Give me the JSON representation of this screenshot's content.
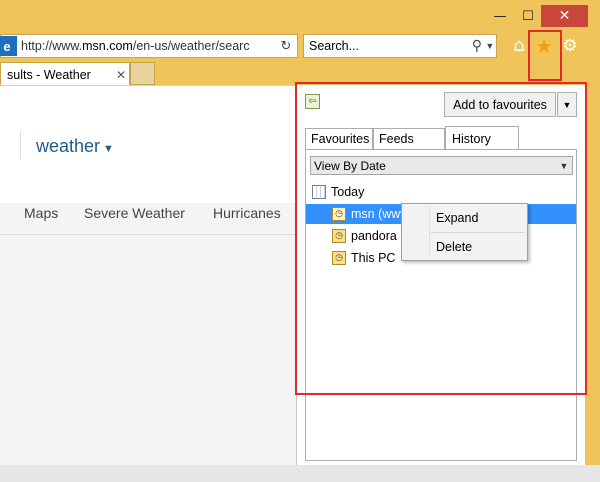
{
  "window": {
    "minimize": "—",
    "maximize": "☐",
    "close": "✕"
  },
  "address_bar": {
    "url_prefix": "http://www.",
    "url_domain": "msn.com",
    "url_suffix": "/en-us/weather/searc"
  },
  "search": {
    "placeholder": "Search..."
  },
  "tab": {
    "title": "sults - Weather"
  },
  "page": {
    "brand": "weather",
    "nav": [
      "Maps",
      "Severe Weather",
      "Hurricanes"
    ]
  },
  "favourites_pane": {
    "add_button": "Add to favourites",
    "tabs": [
      "Favourites",
      "Feeds",
      "History"
    ],
    "view_by": "View By Date",
    "tree": {
      "today": "Today",
      "msn": "msn (www",
      "pandora": "pandora (",
      "this_pc": "This PC"
    }
  },
  "context_menu": {
    "items": [
      "Expand",
      "Delete"
    ]
  },
  "colors": {
    "chrome": "#f0c45a",
    "selection": "#3390ff",
    "highlight": "#e02b2b"
  }
}
